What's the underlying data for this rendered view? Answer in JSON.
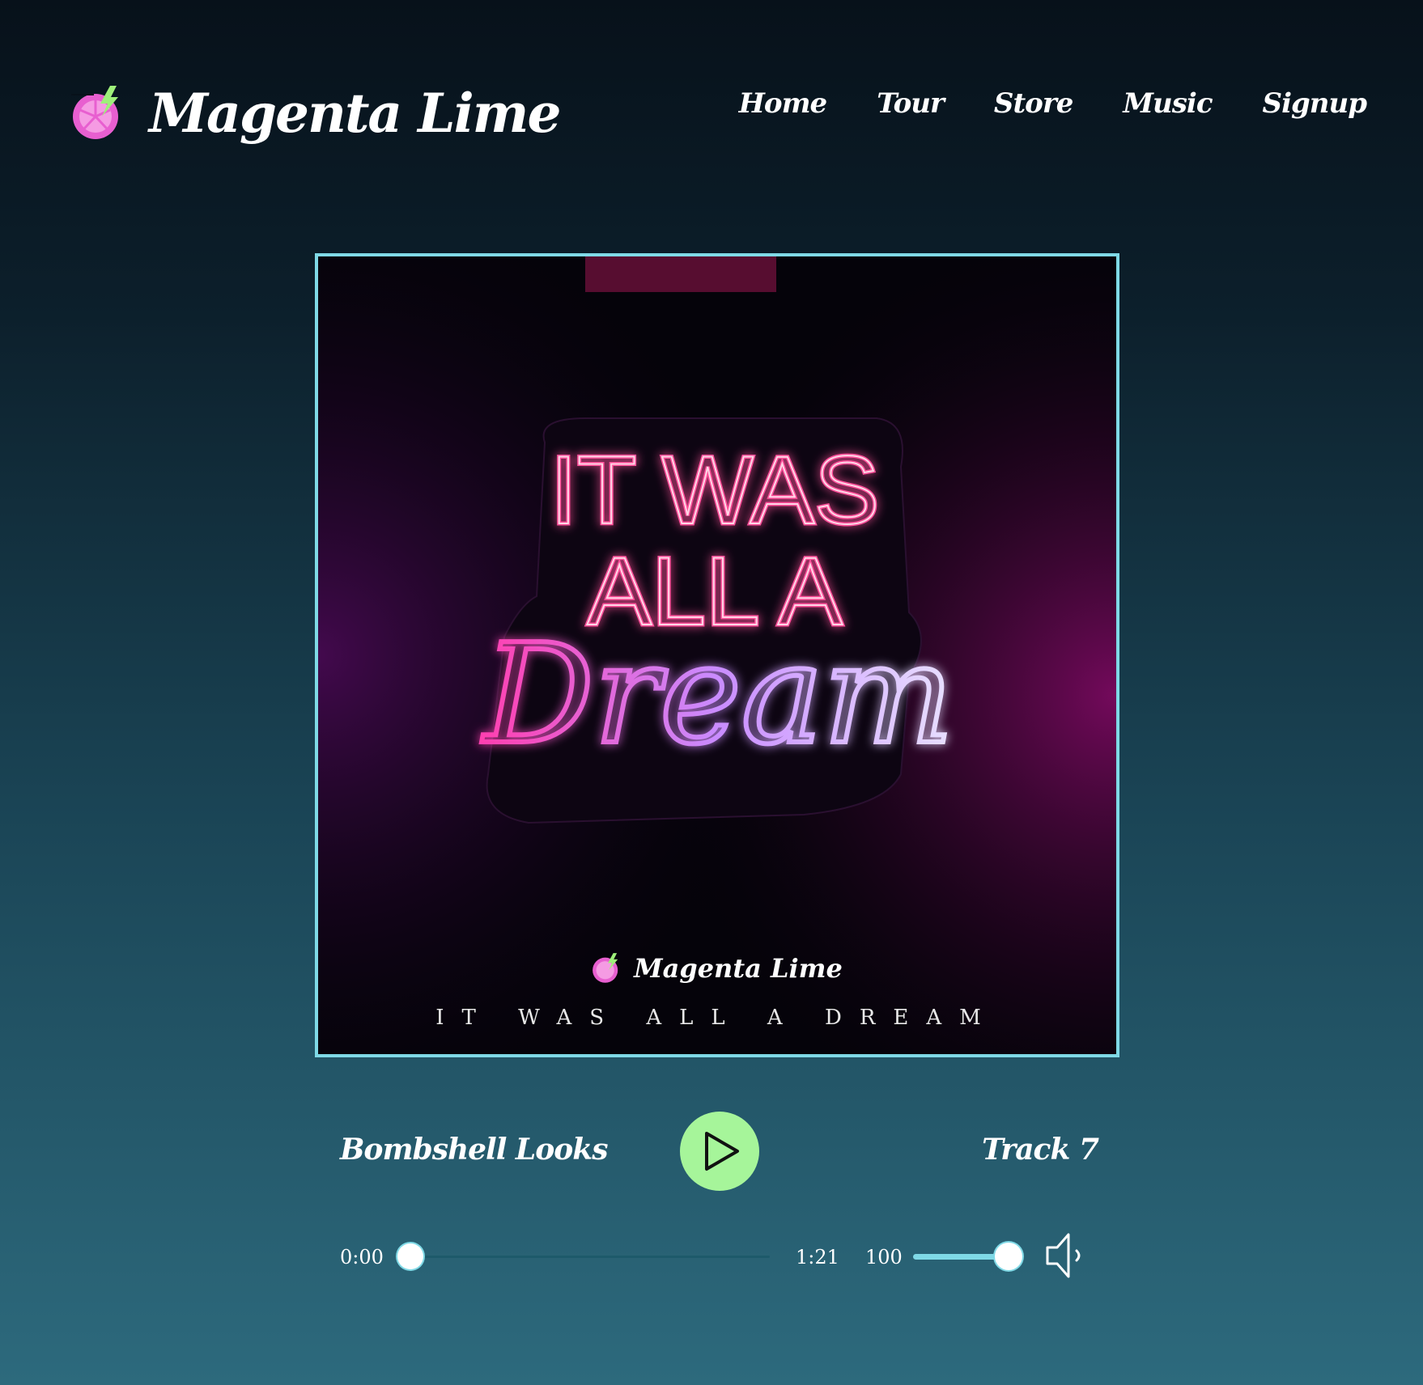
{
  "header": {
    "brand_name": "Magenta Lime",
    "nav": [
      "Home",
      "Tour",
      "Store",
      "Music",
      "Signup"
    ]
  },
  "album": {
    "neon_line1": "IT WAS",
    "neon_line2": "ALL A",
    "neon_line3": "Dream",
    "brand_name": "Magenta Lime",
    "title": "IT WAS ALL A DREAM"
  },
  "player": {
    "track_name": "Bombshell Looks",
    "track_number": "Track 7",
    "time_current": "0:00",
    "time_total": "1:21",
    "progress": 0,
    "volume": "100",
    "volume_level": 1.0,
    "play_icon": "play-icon",
    "volume_icon": "speaker-icon"
  },
  "colors": {
    "accent_cyan": "#7fd9e6",
    "play_green": "#a6f59a",
    "logo_pink": "#e85fd0",
    "logo_lime": "#9ef07a"
  }
}
